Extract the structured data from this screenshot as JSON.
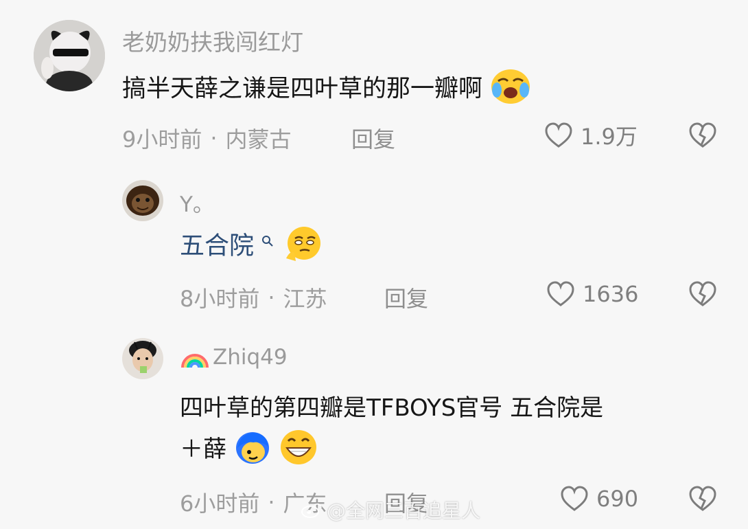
{
  "colors": {
    "background": "#f7f7f7",
    "username": "#9a9a9a",
    "meta": "#9d9d9d",
    "text": "#161616",
    "link": "#2d4e78"
  },
  "comments": [
    {
      "username": "老奶奶扶我闯红灯",
      "text": "搞半天薛之谦是四叶草的那一瓣啊",
      "emojis": [
        "crying-face-emoji"
      ],
      "time": "9小时前",
      "location": "内蒙古",
      "reply_label": "回复",
      "likes": "1.9万"
    },
    {
      "username": "Y。",
      "text": "五合院",
      "emojis": [
        "thinking-face-emoji"
      ],
      "time": "8小时前",
      "location": "江苏",
      "reply_label": "回复",
      "likes": "1636"
    },
    {
      "username": "Zhiq49",
      "text_line1": "四叶草的第四瓣是TFBOYS官号 五合院是",
      "text_line2": "＋薛",
      "emojis": [
        "blue-hair-character-emoji",
        "grinning-face-emoji",
        "rainbow-icon"
      ],
      "time": "6小时前",
      "location": "广东",
      "reply_label": "回复",
      "likes": "690"
    }
  ],
  "watermark": "@全网三百追星人",
  "separator": "·"
}
